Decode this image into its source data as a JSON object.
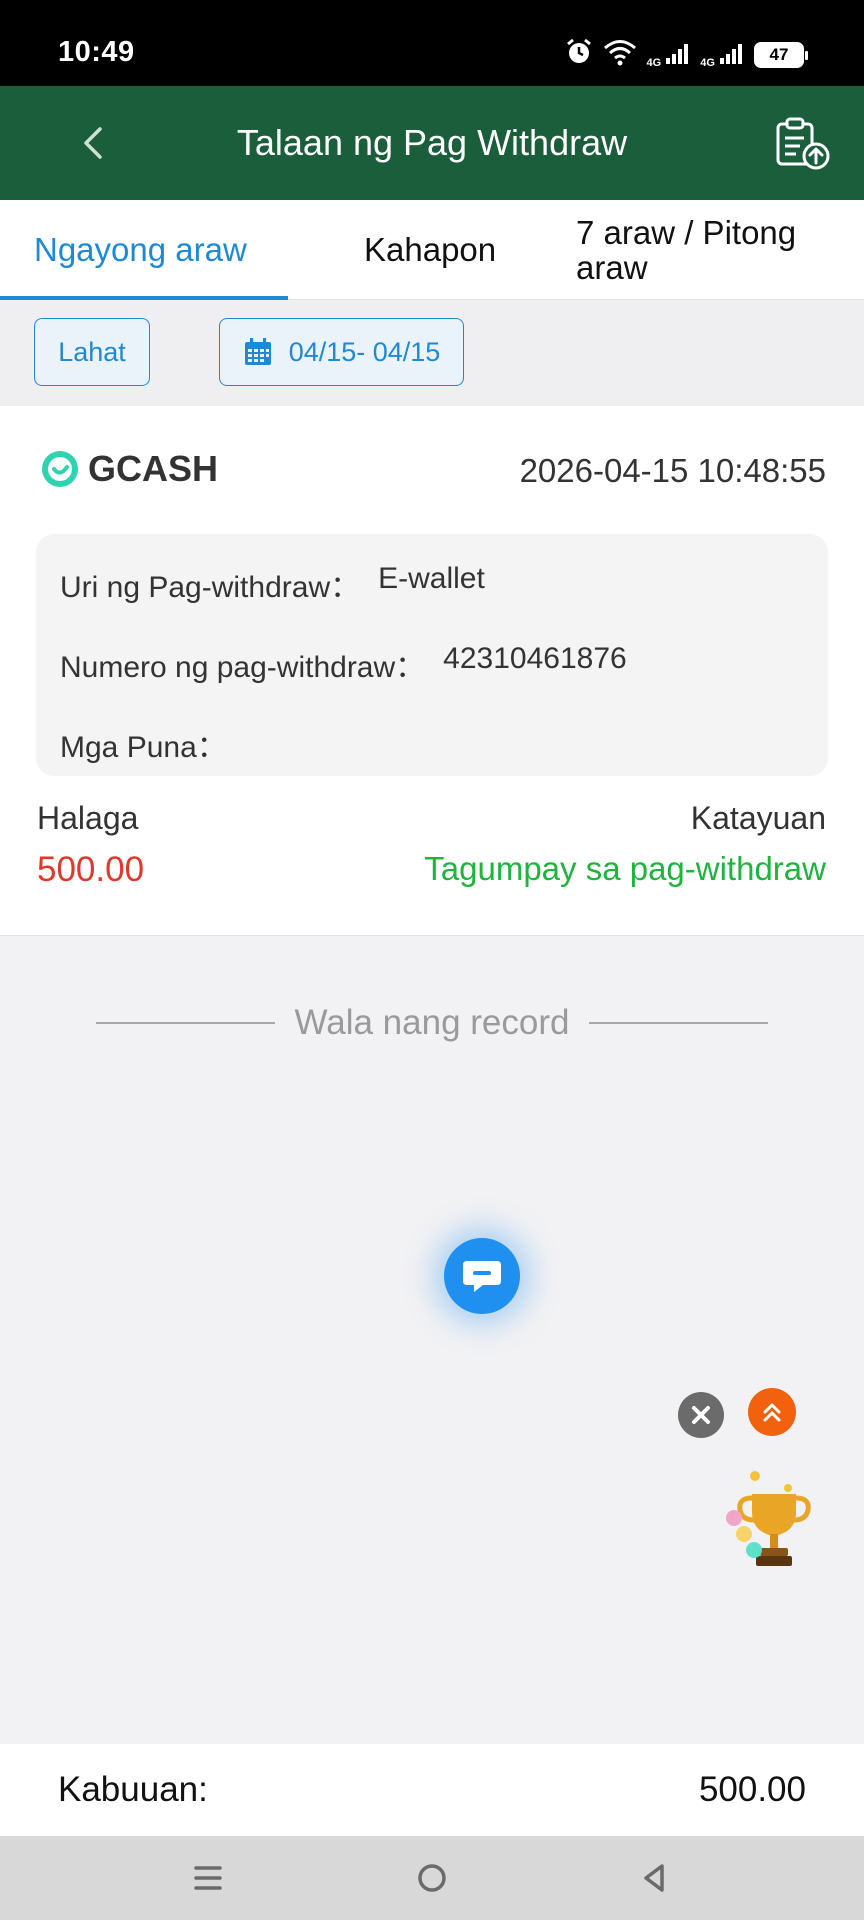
{
  "status_bar": {
    "time": "10:49",
    "net1": "4G",
    "net2": "4G",
    "battery": "47"
  },
  "header": {
    "title": "Talaan ng Pag Withdraw",
    "back_icon": "chevron-left-icon",
    "records_icon": "clipboard-upload-icon",
    "bg_color": "#1b5e3b"
  },
  "tabs": [
    {
      "label": "Ngayong araw",
      "active": true
    },
    {
      "label": "Kahapon",
      "active": false
    },
    {
      "label": "7 araw / Pitong araw",
      "active": false
    }
  ],
  "filters": {
    "all_label": "Lahat",
    "date_range": "04/15- 04/15",
    "date_icon": "calendar-icon"
  },
  "record": {
    "brand": "GCASH",
    "datetime": "2026-04-15 10:48:55",
    "withdraw_type_label": "Uri ng Pag-withdraw：",
    "withdraw_type_value": "E-wallet",
    "withdraw_number_label": "Numero ng pag-withdraw：",
    "withdraw_number_value": "42310461876",
    "remarks_label": "Mga Puna：",
    "remarks_value": "",
    "amount_label": "Halaga",
    "amount_value": "500.00",
    "status_label": "Katayuan",
    "status_value": "Tagumpay sa pag-withdraw",
    "amount_color": "#e0392b",
    "status_color": "#1db53c"
  },
  "no_more_records": "Wala nang record",
  "floating": {
    "chat_icon": "chat-bubble-icon",
    "close_icon": "close-icon",
    "scroll_top_icon": "double-chevron-up-icon",
    "trophy_icon": "trophy-icon"
  },
  "total": {
    "label": "Kabuuan:",
    "value": "500.00"
  },
  "nav": {
    "menu_icon": "menu-icon",
    "home_icon": "home-circle-icon",
    "back_icon": "back-triangle-icon"
  },
  "accent_color": "#1e8ad6"
}
